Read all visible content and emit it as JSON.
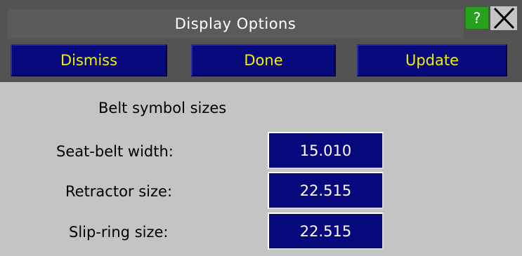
{
  "window": {
    "title": "Display Options",
    "help_label": "?",
    "close_icon": "close-x-icon"
  },
  "toolbar": {
    "dismiss_label": "Dismiss",
    "done_label": "Done",
    "update_label": "Update"
  },
  "section": {
    "title": "Belt symbol sizes"
  },
  "fields": [
    {
      "label": "Seat-belt width:",
      "value": "15.010"
    },
    {
      "label": "Retractor size:",
      "value": "22.515"
    },
    {
      "label": "Slip-ring size:",
      "value": "22.515"
    }
  ],
  "colors": {
    "button_bg": "#08087d",
    "button_text": "#f2ef00",
    "field_bg": "#08087d",
    "help_bg": "#27a11f",
    "panel_bg": "#c4c4c4",
    "bar_bg": "#525252"
  }
}
